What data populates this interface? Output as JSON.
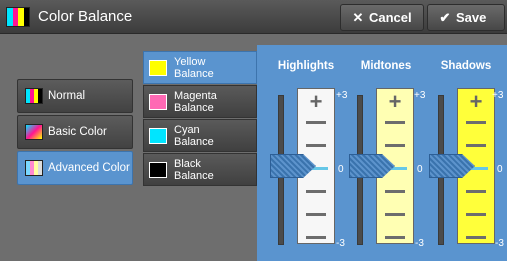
{
  "header": {
    "title": "Color Balance",
    "cancel_label": "Cancel",
    "save_label": "Save"
  },
  "modes": [
    {
      "label": "Normal",
      "active": false
    },
    {
      "label": "Basic Color",
      "active": false
    },
    {
      "label": "Advanced Color",
      "active": true
    }
  ],
  "color_tabs": [
    {
      "line1": "Yellow",
      "line2": "Balance",
      "swatch": "#ffff00",
      "active": true
    },
    {
      "line1": "Magenta",
      "line2": "Balance",
      "swatch": "#ff69b4",
      "active": false
    },
    {
      "line1": "Cyan",
      "line2": "Balance",
      "swatch": "#00e5ff",
      "active": false
    },
    {
      "line1": "Black",
      "line2": "Balance",
      "swatch": "#000000",
      "active": false
    }
  ],
  "adjusters": [
    {
      "label": "Highlights",
      "value": 0,
      "max_label": "+3",
      "mid_label": "0",
      "min_label": "-3",
      "scale_color": "#f7f7f7"
    },
    {
      "label": "Midtones",
      "value": 0,
      "max_label": "+3",
      "mid_label": "0",
      "min_label": "-3",
      "scale_color": "#ffffb3"
    },
    {
      "label": "Shadows",
      "value": 0,
      "max_label": "+3",
      "mid_label": "0",
      "min_label": "-3",
      "scale_color": "#ffff3a"
    }
  ],
  "colors": {
    "accent": "#5a94cf",
    "background": "#6e6e6e"
  }
}
